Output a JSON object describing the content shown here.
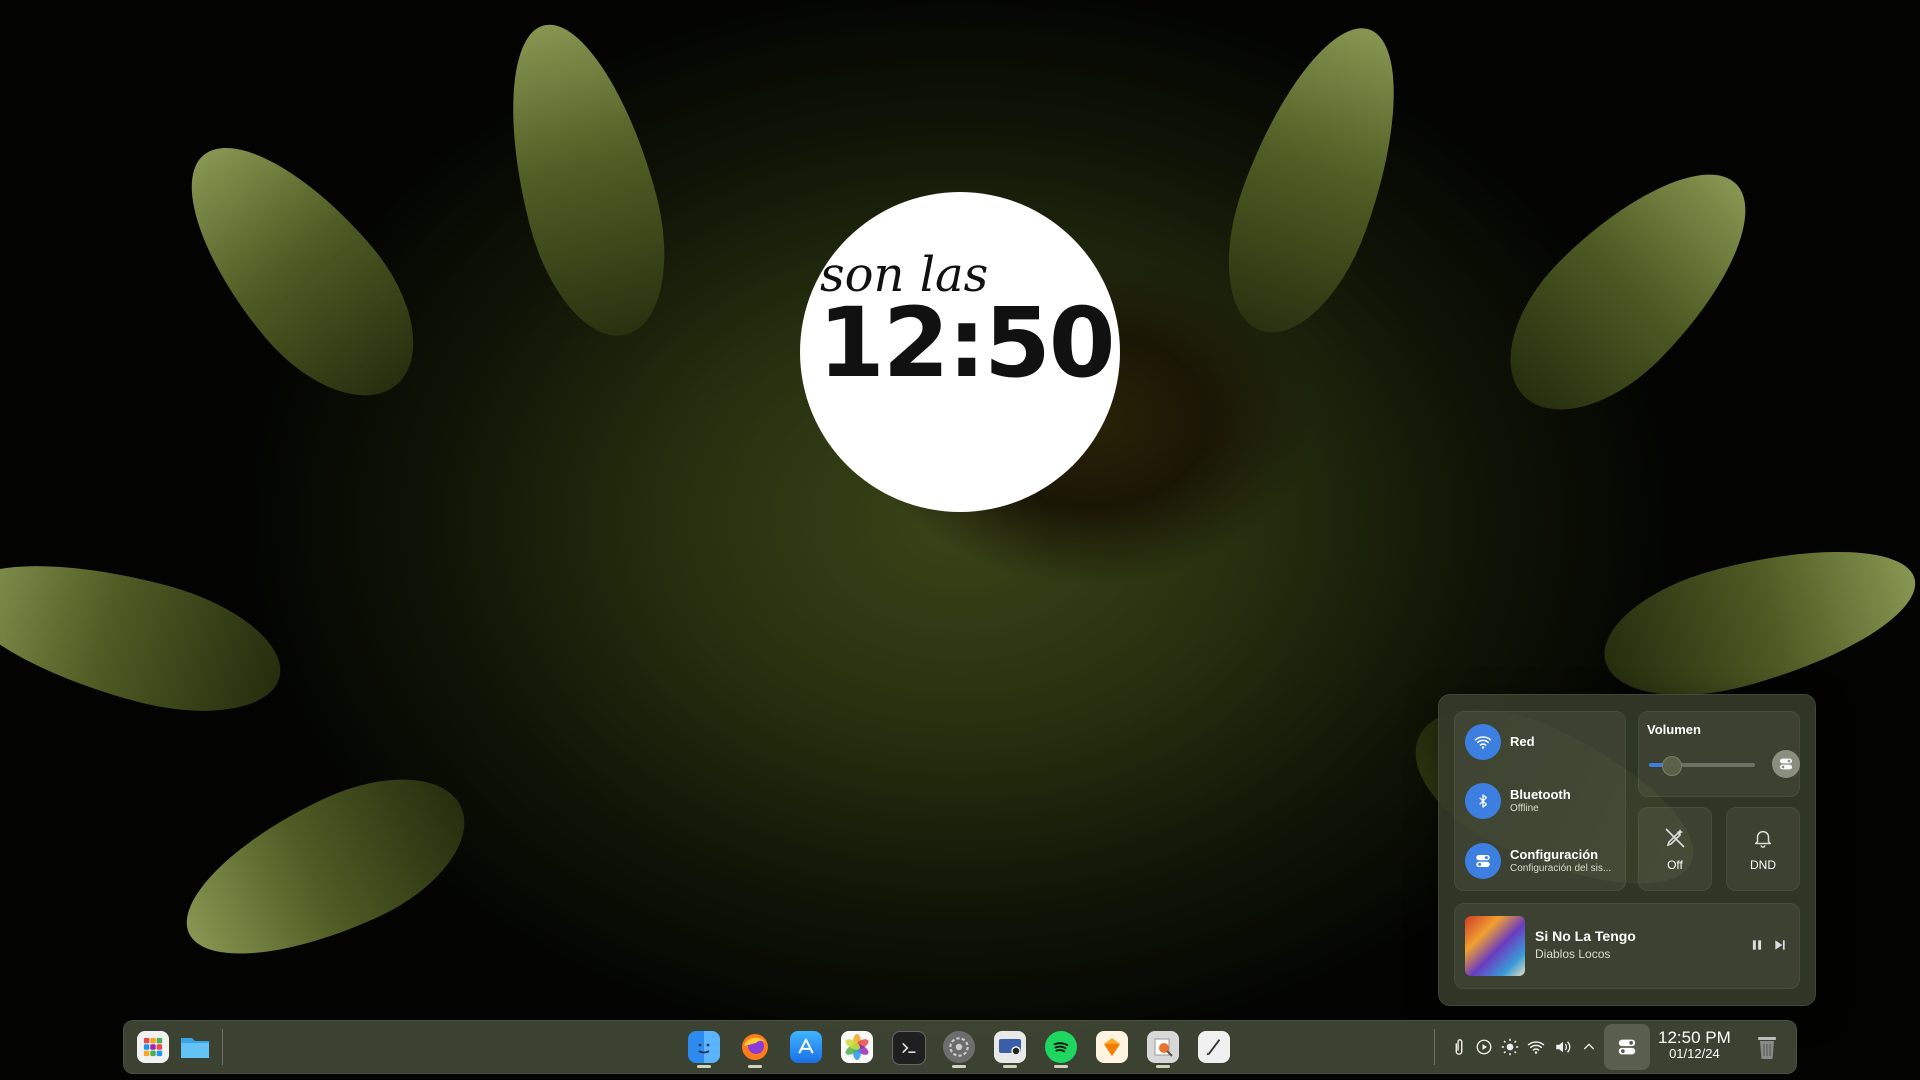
{
  "desktop": {
    "clock_widget": {
      "subtitle": "son las",
      "time": "12:50"
    }
  },
  "quick_settings": {
    "network": {
      "title": "Red"
    },
    "bluetooth": {
      "title": "Bluetooth",
      "status": "Offline"
    },
    "settings": {
      "title": "Configuración",
      "subtitle": "Configuración del sis..."
    },
    "volume": {
      "label": "Volumen",
      "level_percent": 21
    },
    "toggle_off": {
      "label": "Off"
    },
    "dnd": {
      "label": "DND"
    },
    "media": {
      "title": "Si No La Tengo",
      "artist": "Diablos Locos"
    },
    "accent_color": "#3d7fe0"
  },
  "dock": {
    "left_apps": [
      "launcher-icon",
      "files-icon"
    ],
    "apps": [
      "finder-icon",
      "firefox-icon",
      "app-store-icon",
      "photos-icon",
      "terminal-icon",
      "system-settings-icon",
      "screenshot-icon",
      "spotify-icon",
      "sketch-icon",
      "preview-icon",
      "text-editor-icon"
    ],
    "tray_icons": [
      "attachment-icon",
      "media-play-icon",
      "brightness-icon",
      "wifi-icon",
      "volume-icon",
      "chevron-up-icon",
      "quick-settings-icon"
    ],
    "time": "12:50 PM",
    "date": "01/12/24"
  }
}
